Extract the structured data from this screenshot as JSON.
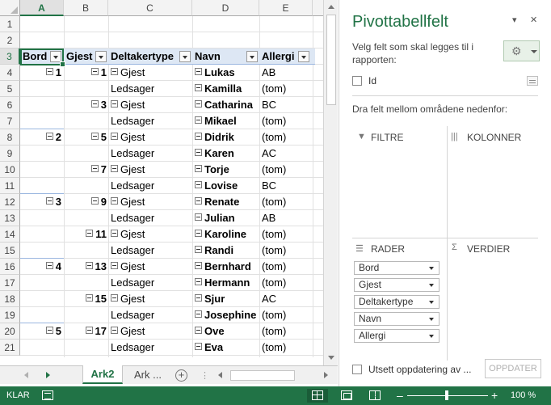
{
  "sheet": {
    "columns": [
      "A",
      "B",
      "C",
      "D",
      "E"
    ],
    "selected_column": "A",
    "selected_row": "3",
    "rows": [
      "1",
      "2",
      "3",
      "4",
      "5",
      "6",
      "7",
      "8",
      "9",
      "10",
      "11",
      "12",
      "13",
      "14",
      "15",
      "16",
      "17",
      "18",
      "19",
      "20",
      "21"
    ],
    "header": [
      "Bord",
      "Gjest",
      "Deltakertype",
      "Navn",
      "Allergi"
    ],
    "data": [
      {
        "bord": "1",
        "gjest": "1",
        "type": "Gjest",
        "navn": "Lukas",
        "allergi": "AB"
      },
      {
        "bord": "",
        "gjest": "",
        "type": "Ledsager",
        "navn": "Kamilla",
        "allergi": "(tom)"
      },
      {
        "bord": "",
        "gjest": "3",
        "type": "Gjest",
        "navn": "Catharina",
        "allergi": "BC"
      },
      {
        "bord": "",
        "gjest": "",
        "type": "Ledsager",
        "navn": "Mikael",
        "allergi": "(tom)"
      },
      {
        "bord": "2",
        "gjest": "5",
        "type": "Gjest",
        "navn": "Didrik",
        "allergi": "(tom)"
      },
      {
        "bord": "",
        "gjest": "",
        "type": "Ledsager",
        "navn": "Karen",
        "allergi": "AC"
      },
      {
        "bord": "",
        "gjest": "7",
        "type": "Gjest",
        "navn": "Torje",
        "allergi": "(tom)"
      },
      {
        "bord": "",
        "gjest": "",
        "type": "Ledsager",
        "navn": "Lovise",
        "allergi": "BC"
      },
      {
        "bord": "3",
        "gjest": "9",
        "type": "Gjest",
        "navn": "Renate",
        "allergi": "(tom)"
      },
      {
        "bord": "",
        "gjest": "",
        "type": "Ledsager",
        "navn": "Julian",
        "allergi": "AB"
      },
      {
        "bord": "",
        "gjest": "11",
        "type": "Gjest",
        "navn": "Karoline",
        "allergi": "(tom)"
      },
      {
        "bord": "",
        "gjest": "",
        "type": "Ledsager",
        "navn": "Randi",
        "allergi": "(tom)"
      },
      {
        "bord": "4",
        "gjest": "13",
        "type": "Gjest",
        "navn": "Bernhard",
        "allergi": "(tom)"
      },
      {
        "bord": "",
        "gjest": "",
        "type": "Ledsager",
        "navn": "Hermann",
        "allergi": "(tom)"
      },
      {
        "bord": "",
        "gjest": "15",
        "type": "Gjest",
        "navn": "Sjur",
        "allergi": "AC"
      },
      {
        "bord": "",
        "gjest": "",
        "type": "Ledsager",
        "navn": "Josephine",
        "allergi": "(tom)"
      },
      {
        "bord": "5",
        "gjest": "17",
        "type": "Gjest",
        "navn": "Ove",
        "allergi": "(tom)"
      },
      {
        "bord": "",
        "gjest": "",
        "type": "Ledsager",
        "navn": "Eva",
        "allergi": "(tom)"
      }
    ]
  },
  "tabs": {
    "active": "Ark2",
    "other": "Ark ..."
  },
  "pivot": {
    "title": "Pivottabellfelt",
    "prompt": "Velg felt som skal legges til i rapporten:",
    "fields": [
      {
        "label": "Id",
        "checked": false
      }
    ],
    "drag_text": "Dra felt mellom områdene nedenfor:",
    "areas": {
      "filters": "FILTRE",
      "columns": "KOLONNER",
      "rows": "RADER",
      "values": "VERDIER"
    },
    "row_fields": [
      "Bord",
      "Gjest",
      "Deltakertype",
      "Navn",
      "Allergi"
    ],
    "defer_label": "Utsett oppdatering av ...",
    "update_button": "OPPDATER"
  },
  "status": {
    "ready": "KLAR",
    "zoom": "100 %"
  },
  "colors": {
    "excel_green": "#217346",
    "pivot_header": "#dde7f4"
  }
}
